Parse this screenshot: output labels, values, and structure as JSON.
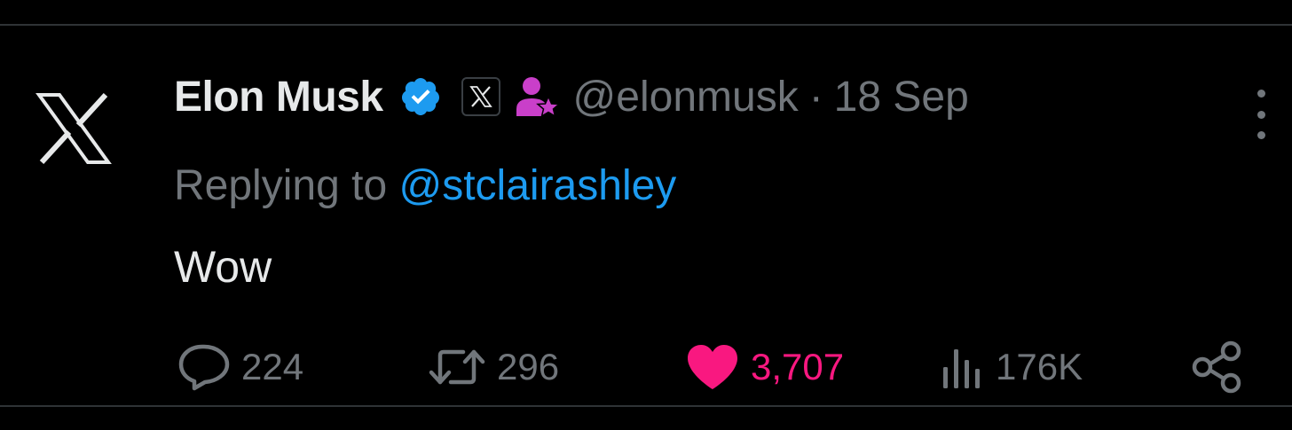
{
  "tweet": {
    "author": {
      "name": "Elon Musk",
      "handle": "@elonmusk",
      "separator": "·",
      "timestamp": "18 Sep"
    },
    "icons": {
      "avatar": "x-logo-icon",
      "verified": "verified-badge-icon",
      "affiliation": "x-affiliation-icon",
      "government": "person-star-icon",
      "more": "more-vertical-icon"
    },
    "reply_prefix": "Replying to ",
    "reply_target": "@stclairashley",
    "text": "Wow",
    "actions": {
      "replies": "224",
      "reposts": "296",
      "likes": "3,707",
      "views": "176K"
    },
    "colors": {
      "background": "#000000",
      "primary_text": "#e7e9ea",
      "secondary_text": "#71767b",
      "link": "#1d9bf0",
      "verified": "#1d9bf0",
      "like": "#f91880",
      "gov_icon": "#c93fc9",
      "divider": "#2f3336"
    }
  }
}
